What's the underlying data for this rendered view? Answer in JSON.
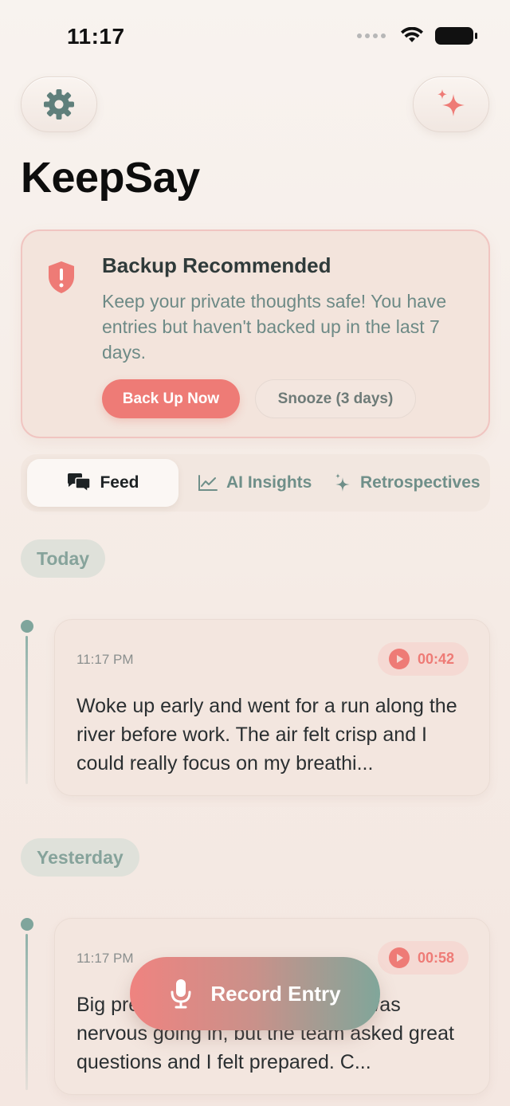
{
  "status_bar": {
    "time": "11:17"
  },
  "header": {
    "settings_icon": "gear-icon",
    "sparkle_icon": "sparkles-icon",
    "title": "KeepSay"
  },
  "backup_banner": {
    "icon": "shield-alert-icon",
    "title": "Backup Recommended",
    "message": "Keep your private thoughts safe! You have entries but haven't backed up in the last 7 days.",
    "primary_label": "Back Up Now",
    "secondary_label": "Snooze (3 days)"
  },
  "tabs": [
    {
      "label": "Feed",
      "icon": "chat-bubbles-icon",
      "selected": true
    },
    {
      "label": "AI Insights",
      "icon": "chart-line-icon",
      "selected": false
    },
    {
      "label": "Retrospectives",
      "icon": "sparkle-icon",
      "selected": false
    }
  ],
  "feed": {
    "sections": [
      {
        "label": "Today",
        "entries": [
          {
            "time": "11:17 PM",
            "duration": "00:42",
            "text": "Woke up early and went for a run along the river before work. The air felt crisp and I could really focus on my breathi..."
          }
        ]
      },
      {
        "label": "Yesterday",
        "entries": [
          {
            "time": "11:17 PM",
            "duration": "00:58",
            "text": "Big presentation at work today. I was nervous going in, but the team asked great questions and I felt prepared. C..."
          }
        ]
      }
    ]
  },
  "record_button": {
    "label": "Record Entry",
    "icon": "microphone-icon"
  },
  "colors": {
    "accent": "#ee7b76",
    "sage": "#7fa59c",
    "background": "#f6eee9"
  }
}
